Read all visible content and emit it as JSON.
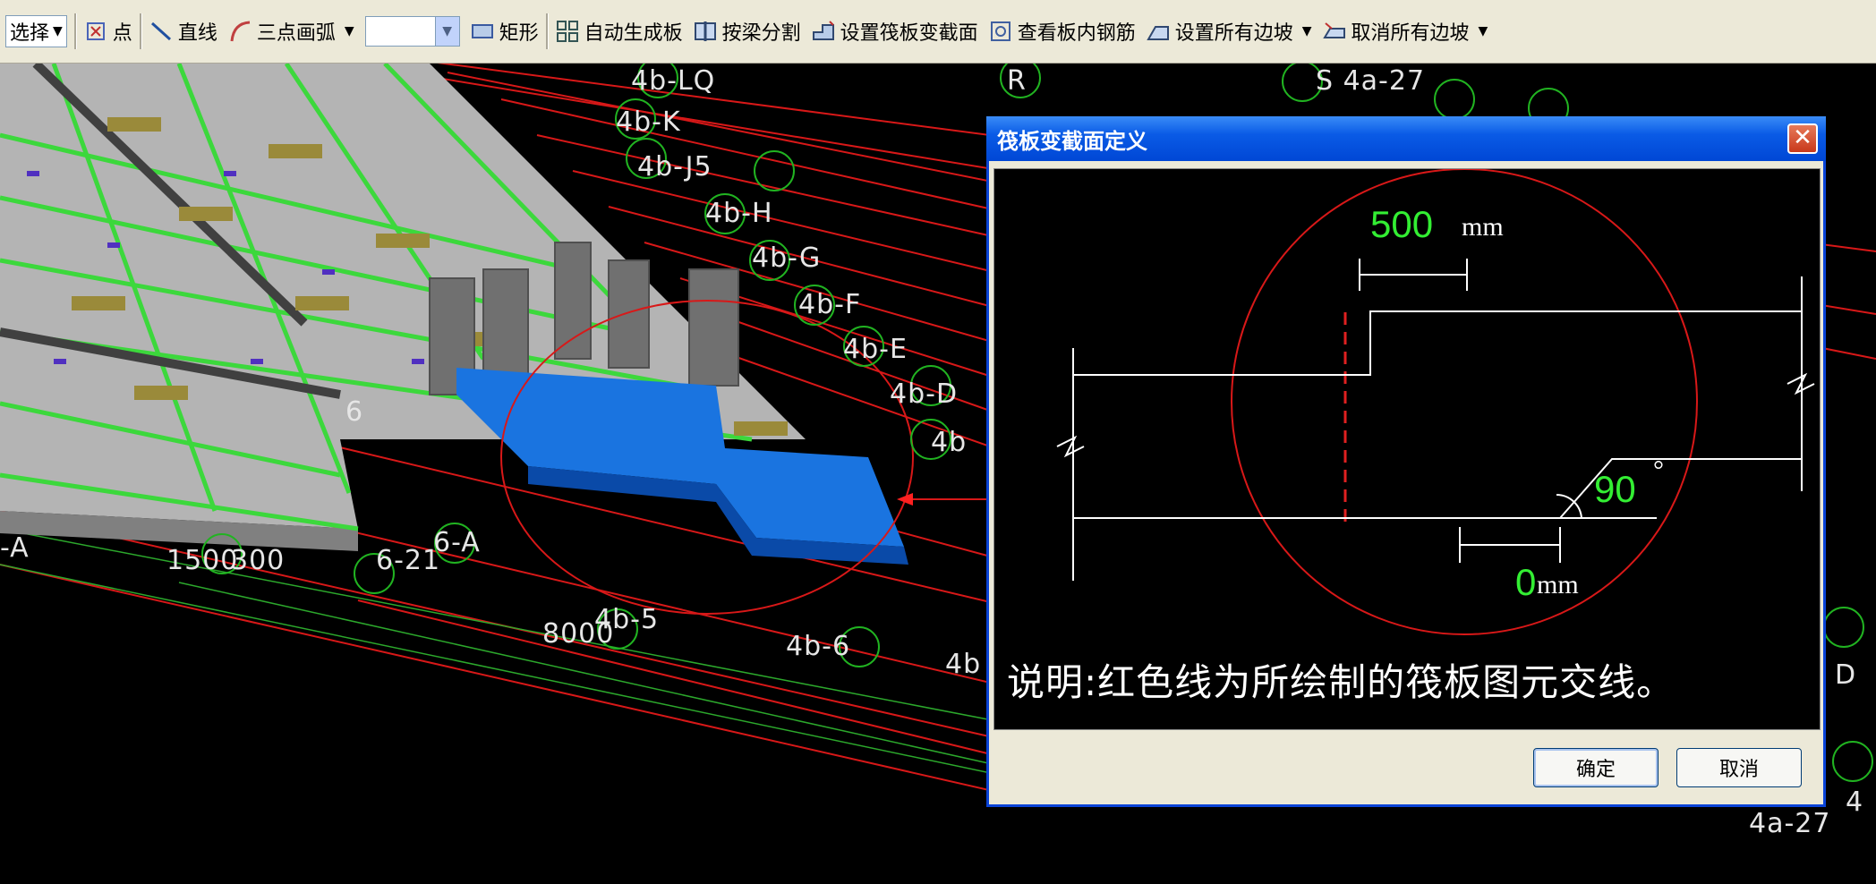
{
  "toolbar": {
    "select_label": "选择",
    "point_label": "点",
    "line_label": "直线",
    "arc_label": "三点画弧",
    "rect_label": "矩形",
    "auto_board_label": "自动生成板",
    "split_by_beam_label": "按梁分割",
    "set_section_label": "设置筏板变截面",
    "view_rebar_label": "查看板内钢筋",
    "set_slopes_label": "设置所有边坡",
    "cancel_slopes_label": "取消所有边坡"
  },
  "scene": {
    "labels": [
      "4b-LQ",
      "R",
      "S 4a-27",
      "4b-K",
      "4b-J5",
      "4b-H",
      "4b-G",
      "4b-F",
      "4b-E",
      "4b-D",
      "4b",
      "6-A",
      "1500",
      "300",
      "6-21",
      "8000",
      "4b-5",
      "4b-6",
      "4b",
      "-A",
      "6",
      "4a-27",
      "D",
      "4"
    ]
  },
  "dialog": {
    "title": "筏板变截面定义",
    "width_value": "500",
    "width_unit": "mm",
    "angle_value": "90",
    "angle_unit": "°",
    "offset_value": "0",
    "offset_unit": "mm",
    "note": "说明:红色线为所绘制的筏板图元交线。",
    "ok_label": "确定",
    "cancel_label": "取消"
  }
}
